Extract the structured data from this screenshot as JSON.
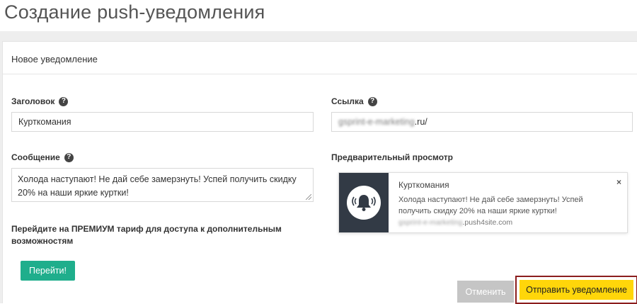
{
  "page": {
    "title": "Создание push-уведомления"
  },
  "panel": {
    "heading": "Новое уведомление"
  },
  "form": {
    "title_label": "Заголовок",
    "title_value": "Курткомания",
    "link_label": "Ссылка",
    "link_value_hidden": "gsprint-e-marketing",
    "link_value_visible": ".ru/",
    "message_label": "Сообщение",
    "message_value": "Холода наступают! Не дай себе замерзнуть! Успей получить скидку 20% на наши яркие куртки!",
    "preview_label": "Предварительный просмотр"
  },
  "premium": {
    "text": "Перейдите на ПРЕМИУМ тариф для доступа к дополнительным возможностям",
    "button_label": "Перейти!"
  },
  "preview": {
    "title": "Курткомания",
    "body": "Холода наступают! Не дай себе замерзнуть! Успей получить скидку 20% на наши яркие куртки!",
    "url_hidden": "gsprint-e-marketing",
    "url_visible": ".push4site.com",
    "close": "×",
    "icon": "bell-icon"
  },
  "actions": {
    "cancel_label": "Отменить",
    "send_label": "Отправить уведомление"
  },
  "colors": {
    "accent_green": "#1fae8c",
    "send_yellow": "#ffd60a",
    "highlight_border": "#8b1d1d",
    "cancel_gray": "#c5c5c5"
  }
}
